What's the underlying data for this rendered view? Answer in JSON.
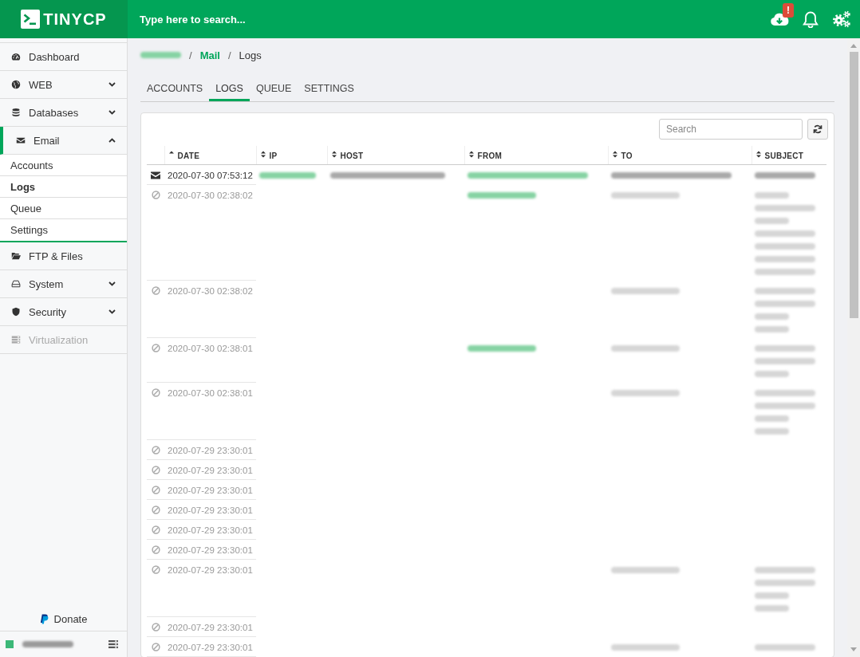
{
  "topbar": {
    "logo": "TINYCP",
    "search": {
      "placeholder": "Type here to search..."
    },
    "update_badge": "!"
  },
  "sidebar": {
    "items": [
      {
        "label": "Dashboard",
        "selected": false,
        "disabled": false
      },
      {
        "label": "WEB",
        "expanded": false,
        "selected": false,
        "disabled": false
      },
      {
        "label": "Databases",
        "expanded": false,
        "selected": false,
        "disabled": false
      },
      {
        "label": "Email",
        "expanded": true,
        "selected": true,
        "disabled": false,
        "children": [
          {
            "label": "Accounts",
            "selected": false
          },
          {
            "label": "Logs",
            "selected": true
          },
          {
            "label": "Queue",
            "selected": false
          },
          {
            "label": "Settings",
            "selected": false
          }
        ]
      },
      {
        "label": "FTP & Files",
        "selected": false,
        "disabled": false
      },
      {
        "label": "System",
        "expanded": false,
        "selected": false,
        "disabled": false
      },
      {
        "label": "Security",
        "expanded": false,
        "selected": false,
        "disabled": false
      },
      {
        "label": "Virtualization",
        "selected": false,
        "disabled": true
      }
    ],
    "donate": "Donate",
    "server": {
      "online": true,
      "name": {
        "link": false,
        "lines": [
          {
            "wide": true
          }
        ]
      }
    }
  },
  "breadcrumb": {
    "separator": "/",
    "items": [
      {
        "kind": "blurred",
        "link": true,
        "lines": [
          {
            "wide": true
          }
        ]
      },
      {
        "kind": "link",
        "label": "Mail"
      },
      {
        "kind": "current",
        "label": "Logs"
      }
    ]
  },
  "tabs": [
    {
      "label": "ACCOUNTS",
      "selected": false
    },
    {
      "label": "LOGS",
      "selected": true
    },
    {
      "label": "QUEUE",
      "selected": false
    },
    {
      "label": "SETTINGS",
      "selected": false
    }
  ],
  "logs": {
    "search": {
      "placeholder": "Search"
    },
    "columns": [
      {
        "label": "DATE",
        "sorted": true
      },
      {
        "label": "IP",
        "sorted": false
      },
      {
        "label": "HOST",
        "sorted": false
      },
      {
        "label": "FROM",
        "sorted": false
      },
      {
        "label": "TO",
        "sorted": false
      },
      {
        "label": "SUBJECT",
        "sorted": false
      }
    ],
    "rows": [
      {
        "kind": "mail",
        "date": "2020-07-30 07:53:12",
        "ip": {
          "link": true,
          "lines": [
            {
              "wide": true
            }
          ]
        },
        "host": {
          "link": false,
          "lines": [
            {
              "wide": true
            }
          ]
        },
        "from": {
          "link": true,
          "lines": [
            {
              "wide": true
            }
          ]
        },
        "to": {
          "link": false,
          "lines": [
            {
              "wide": true
            }
          ]
        },
        "subject": {
          "link": false,
          "lines": [
            {
              "wide": true
            }
          ]
        }
      },
      {
        "kind": "blocked",
        "date": "2020-07-30 02:38:02",
        "from": {
          "link": true,
          "lines": [
            {
              "wide": false
            }
          ]
        },
        "to": {
          "link": false,
          "lines": [
            {
              "wide": false
            }
          ]
        },
        "subject": {
          "link": false,
          "lines": [
            {
              "wide": false
            },
            {
              "wide": true
            },
            {
              "wide": false
            },
            {
              "wide": true
            },
            {
              "wide": true
            },
            {
              "wide": true
            },
            {
              "wide": true
            }
          ]
        }
      },
      {
        "kind": "blocked",
        "date": "2020-07-30 02:38:02",
        "to": {
          "link": false,
          "lines": [
            {
              "wide": false
            }
          ]
        },
        "subject": {
          "link": false,
          "lines": [
            {
              "wide": true
            },
            {
              "wide": true
            },
            {
              "wide": false
            },
            {
              "wide": false
            }
          ]
        }
      },
      {
        "kind": "blocked",
        "date": "2020-07-30 02:38:01",
        "from": {
          "link": true,
          "lines": [
            {
              "wide": false
            }
          ]
        },
        "to": {
          "link": false,
          "lines": [
            {
              "wide": false
            }
          ]
        },
        "subject": {
          "link": false,
          "lines": [
            {
              "wide": true
            },
            {
              "wide": true
            },
            {
              "wide": false
            }
          ]
        }
      },
      {
        "kind": "blocked",
        "date": "2020-07-30 02:38:01",
        "to": {
          "link": false,
          "lines": [
            {
              "wide": false
            }
          ]
        },
        "subject": {
          "link": false,
          "lines": [
            {
              "wide": true
            },
            {
              "wide": true
            },
            {
              "wide": false
            },
            {
              "wide": false
            }
          ]
        }
      },
      {
        "kind": "blocked",
        "date": "2020-07-29 23:30:01"
      },
      {
        "kind": "blocked",
        "date": "2020-07-29 23:30:01"
      },
      {
        "kind": "blocked",
        "date": "2020-07-29 23:30:01"
      },
      {
        "kind": "blocked",
        "date": "2020-07-29 23:30:01"
      },
      {
        "kind": "blocked",
        "date": "2020-07-29 23:30:01"
      },
      {
        "kind": "blocked",
        "date": "2020-07-29 23:30:01"
      },
      {
        "kind": "blocked",
        "date": "2020-07-29 23:30:01",
        "to": {
          "link": false,
          "lines": [
            {
              "wide": false
            }
          ]
        },
        "subject": {
          "link": false,
          "lines": [
            {
              "wide": true
            },
            {
              "wide": true
            },
            {
              "wide": false
            },
            {
              "wide": false
            }
          ]
        }
      },
      {
        "kind": "blocked",
        "date": "2020-07-29 23:30:01"
      },
      {
        "kind": "blocked",
        "date": "2020-07-29 23:30:01",
        "to": {
          "link": false,
          "lines": [
            {
              "wide": false
            }
          ]
        },
        "subject": {
          "link": false,
          "lines": [
            {
              "wide": true
            }
          ]
        }
      }
    ]
  }
}
